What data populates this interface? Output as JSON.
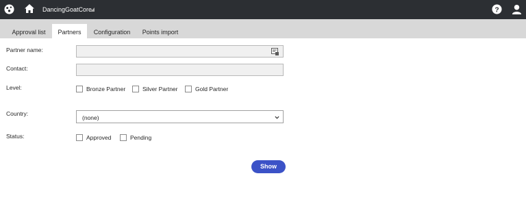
{
  "header": {
    "site_name": "DancingGoatCore",
    "icons": [
      "kentico-logo-icon",
      "home-icon",
      "caret-icon",
      "help-icon",
      "user-icon"
    ]
  },
  "tabs": [
    {
      "label": "Approval list",
      "active": false
    },
    {
      "label": "Partners",
      "active": true
    },
    {
      "label": "Configuration",
      "active": false
    },
    {
      "label": "Points import",
      "active": false
    }
  ],
  "form": {
    "partner_name_label": "Partner name:",
    "partner_name_value": "",
    "contact_label": "Contact:",
    "contact_value": "",
    "level_label": "Level:",
    "levels": [
      "Bronze Partner",
      "Silver Partner",
      "Gold Partner"
    ],
    "country_label": "Country:",
    "country_value": "(none)",
    "status_label": "Status:",
    "statuses": [
      "Approved",
      "Pending"
    ],
    "show_button": "Show"
  },
  "colors": {
    "topbar": "#2c2f33",
    "tabbar": "#d8d8d8",
    "button": "#3b52c7"
  }
}
